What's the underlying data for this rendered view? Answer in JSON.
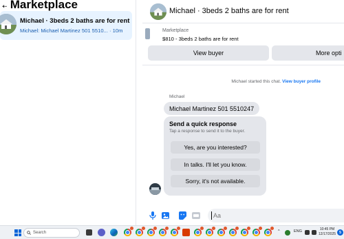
{
  "sidebar": {
    "title": "Marketplace",
    "conversation": {
      "title": "Michael · 3beds 2 baths are for rent",
      "subtitle": "Michael: Michael Martinez 501 5510...",
      "time": "· 10m"
    }
  },
  "chat": {
    "header_title": "Michael · 3beds 2 baths are for rent",
    "listing": {
      "label": "Marketplace",
      "price_title": "$810 - 3beds 2 baths are for rent",
      "view_buyer_label": "View buyer",
      "more_options_label": "More opti"
    },
    "system_message": "Michael started this chat.",
    "system_link": "View buyer profile",
    "sender_name": "Michael",
    "message_text": "Michael Martinez 501 5510247",
    "quick_response": {
      "title": "Send a quick response",
      "subtitle": "Tap a response to send it to the buyer.",
      "options": [
        "Yes, are you interested?",
        "In talks. I'll let you know.",
        "Sorry, it's not available."
      ]
    },
    "composer": {
      "placeholder": "Aa",
      "icons": [
        "microphone-icon",
        "image-icon",
        "sticker-icon",
        "gif-icon"
      ]
    }
  },
  "taskbar": {
    "search_placeholder": "Search",
    "tray_lang": "ENG",
    "time": "10:45 PM",
    "date": "12/17/2025",
    "notification_count": "5"
  },
  "colors": {
    "accent": "#1877f2",
    "selected_bg": "#e7f3ff",
    "bubble_bg": "#e4e6eb",
    "taskbar_bg": "#eef1f5"
  }
}
